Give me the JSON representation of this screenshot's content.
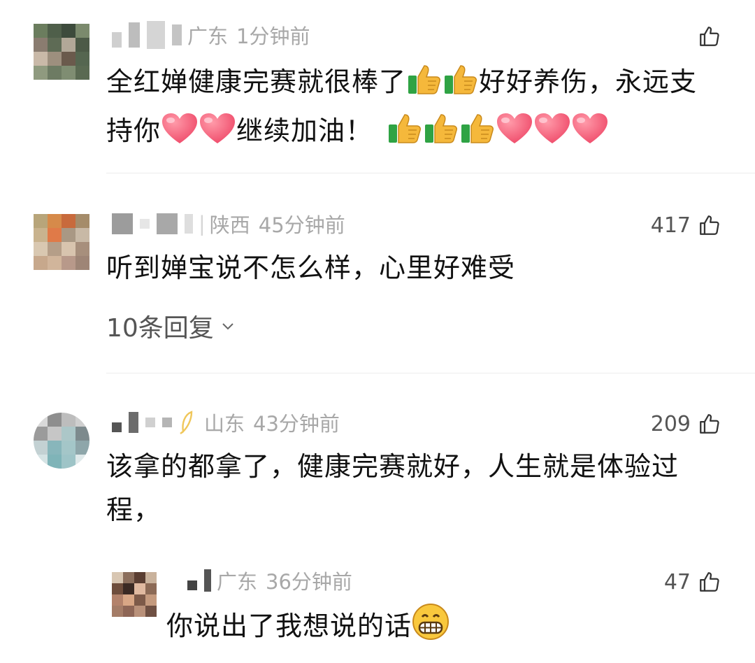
{
  "comments": [
    {
      "location": "广东",
      "time": "1分钟前",
      "likes": "",
      "text_line1": "全红婵健康完赛就很棒了",
      "text_line1_after": "好好养伤，永远支",
      "text_line2_a": "持你",
      "text_line2_b": "继续加油！",
      "emojis": [
        "thumbs-up",
        "thumbs-up",
        "heart",
        "heart",
        "thumbs-up",
        "thumbs-up",
        "thumbs-up",
        "heart",
        "heart",
        "heart"
      ]
    },
    {
      "location": "陕西",
      "time": "45分钟前",
      "likes": "417",
      "text_line1": "听到婵宝说不怎么样，心里好难受",
      "replies": "10条回复"
    },
    {
      "location": "山东",
      "time": "43分钟前",
      "likes": "209",
      "text_line1": "该拿的都拿了，健康完赛就好，人生就是体验过",
      "text_line2": "程，"
    },
    {
      "location": "广东",
      "time": "36分钟前",
      "likes": "47",
      "text_line1": "你说出了我想说的话",
      "emojis": [
        "grin"
      ]
    }
  ],
  "colors": {
    "meta": "#a8a8a8",
    "text": "#111111",
    "divider": "#ececec",
    "heart": "#ef4b6a",
    "thumb": "#f5b83b",
    "cuff": "#2fa344"
  },
  "icons": {
    "like": "thumbs-up-outline-icon",
    "expand": "chevron-down-icon"
  }
}
